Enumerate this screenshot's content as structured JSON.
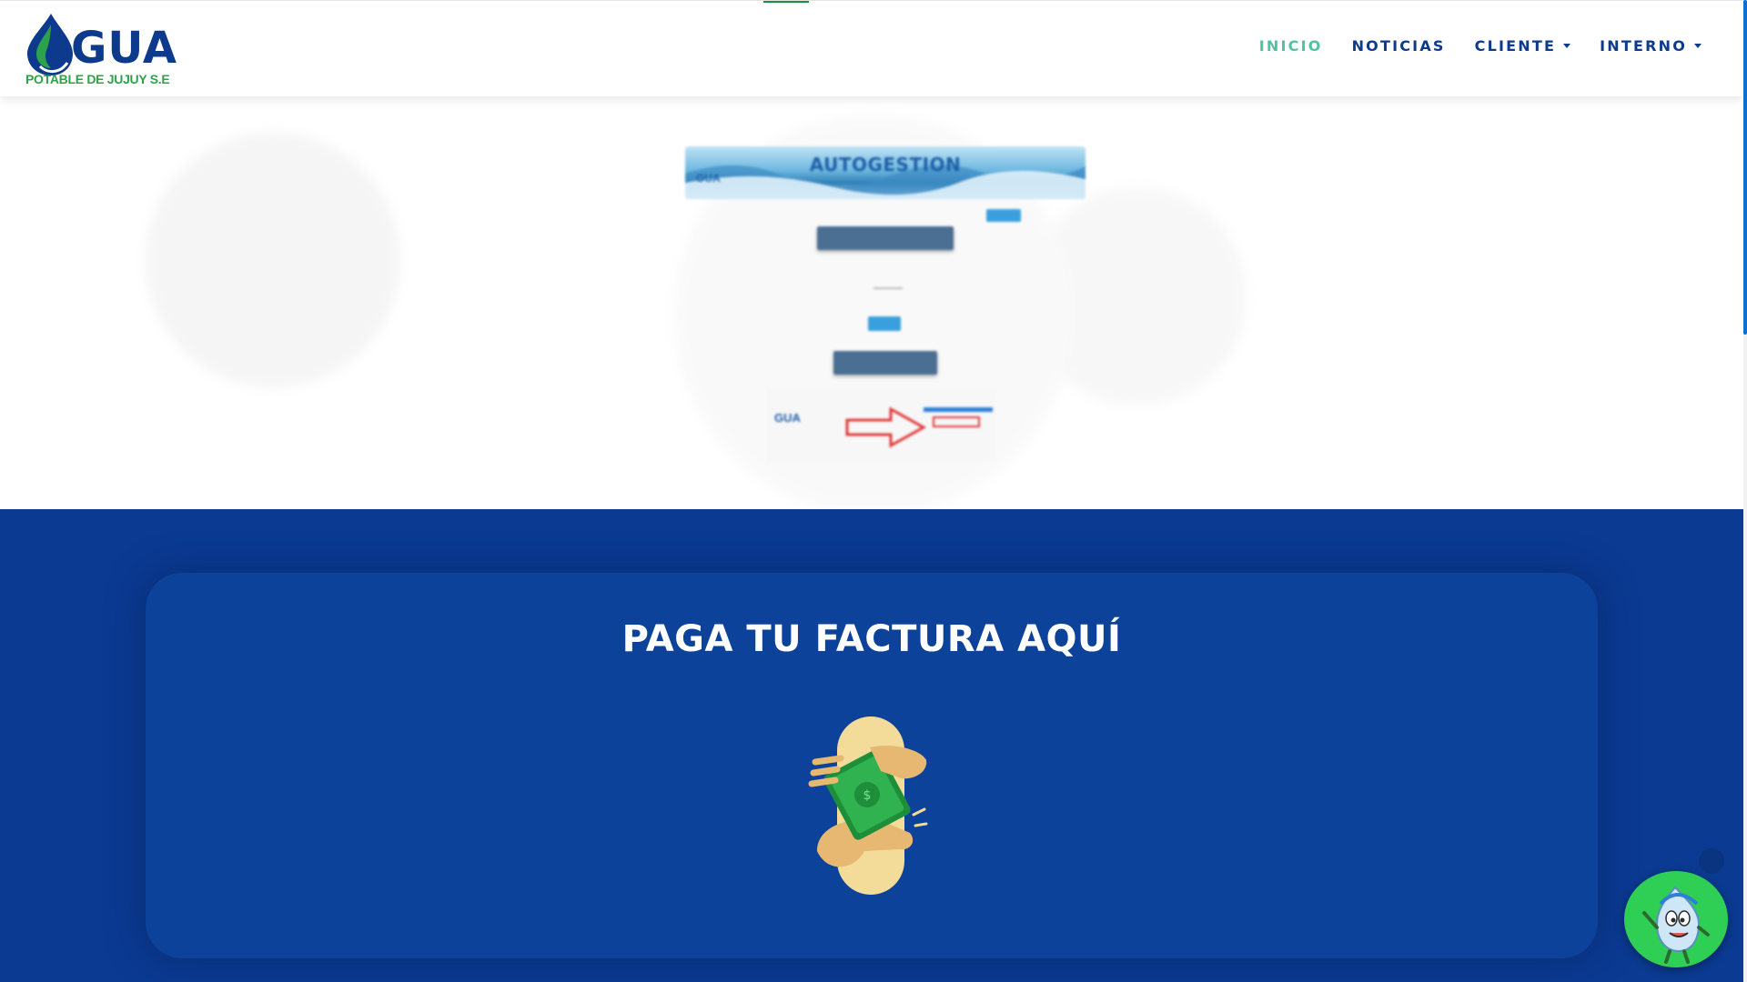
{
  "header": {
    "logo_main": "GUA",
    "logo_sub": "POTABLE DE JUJUY S.E",
    "nav": [
      {
        "label": "INICIO",
        "active": true
      },
      {
        "label": "NOTICIAS",
        "active": false
      },
      {
        "label": "CLIENTE",
        "active": false,
        "dropdown": true
      },
      {
        "label": "INTERNO",
        "active": false,
        "dropdown": true
      }
    ]
  },
  "hero": {
    "banner_title": "AUTOGESTION",
    "banner_logo": "GUA",
    "invoice_logo": "GUA"
  },
  "pay_section": {
    "title": "PAGA TU FACTURA AQUÍ"
  },
  "colors": {
    "brand_blue": "#0d3a8c",
    "brand_green": "#2ca34a",
    "nav_active": "#4fc3a1",
    "section_blue": "#0b3a92",
    "chat_green": "#2fcf55"
  },
  "icons": [
    "water-drop-logo-icon",
    "hand-money-icon",
    "chat-mascot-icon",
    "caret-down-icon"
  ]
}
